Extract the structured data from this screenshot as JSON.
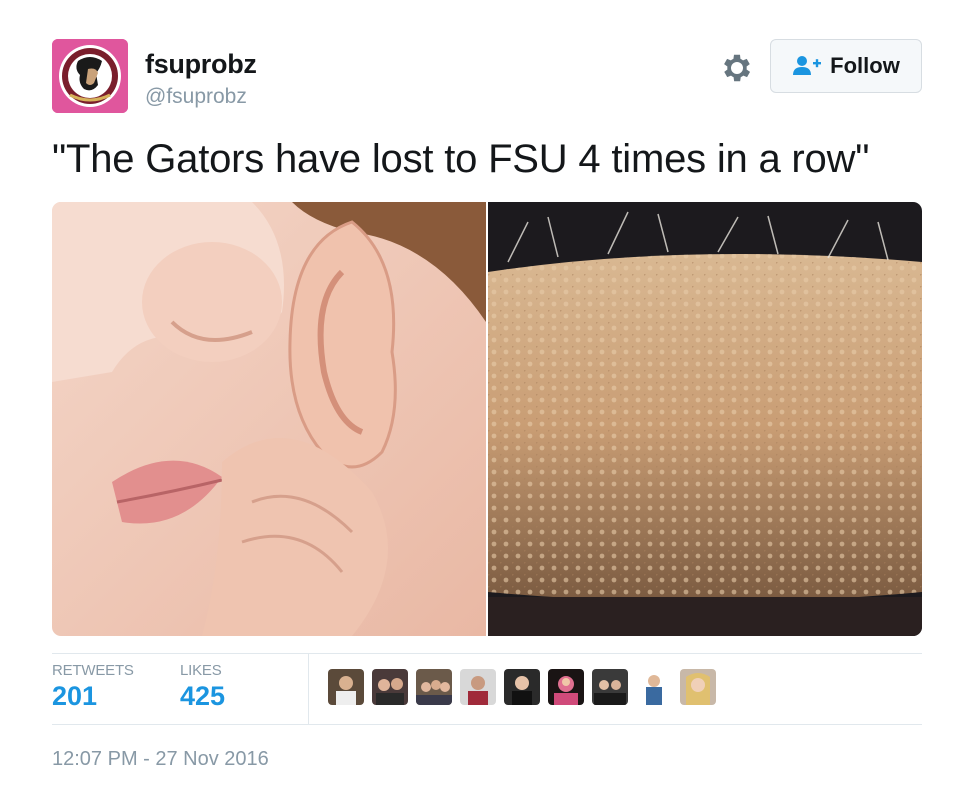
{
  "author": {
    "display_name": "fsuprobz",
    "handle": "@fsuprobz",
    "avatar_icon": "fsu-seminole-logo",
    "avatar_bg": "#e0569d"
  },
  "actions": {
    "settings_icon": "gear-icon",
    "follow_label": "Follow",
    "follow_icon": "add-user-icon",
    "accent": "#1b95e0"
  },
  "tweet": {
    "text": "\"The Gators have lost to FSU 4 times in a row\"",
    "media": [
      {
        "name": "whisper-ear-photo"
      },
      {
        "name": "goosebumps-arm-photo"
      }
    ]
  },
  "stats": {
    "retweets_label": "RETWEETS",
    "retweets_value": "201",
    "likes_label": "LIKES",
    "likes_value": "425"
  },
  "liked_by_count_shown": 9,
  "timestamp": "12:07 PM - 27 Nov 2016"
}
